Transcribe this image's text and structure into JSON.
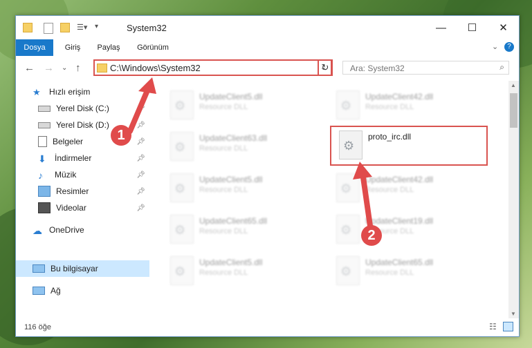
{
  "window": {
    "title": "System32",
    "controls": [
      "—",
      "☐",
      "✕"
    ]
  },
  "ribbon": {
    "tabs": [
      "Dosya",
      "Giriş",
      "Paylaş",
      "Görünüm"
    ]
  },
  "nav": {
    "address": "C:\\Windows\\System32",
    "search_placeholder": "Ara: System32"
  },
  "sidebar": {
    "items": [
      {
        "label": "Hızlı erişim",
        "icon": "star-icon"
      },
      {
        "label": "Yerel Disk (C:)",
        "icon": "drive-icon",
        "pinned": true
      },
      {
        "label": "Yerel Disk (D:)",
        "icon": "drive-icon",
        "pinned": true
      },
      {
        "label": "Belgeler",
        "icon": "documents-icon",
        "pinned": true
      },
      {
        "label": "İndirmeler",
        "icon": "download-icon",
        "pinned": true
      },
      {
        "label": "Müzik",
        "icon": "music-icon",
        "pinned": true
      },
      {
        "label": "Resimler",
        "icon": "pictures-icon",
        "pinned": true
      },
      {
        "label": "Videolar",
        "icon": "videos-icon",
        "pinned": true
      },
      {
        "label": "OneDrive",
        "icon": "onedrive-icon"
      },
      {
        "label": "Bu bilgisayar",
        "icon": "computer-icon",
        "selected": true
      },
      {
        "label": "Ağ",
        "icon": "network-icon"
      }
    ]
  },
  "files": [
    {
      "name": "UpdateClient5.dll",
      "desc": "Resource DLL"
    },
    {
      "name": "UpdateClient42.dll",
      "desc": "Resource DLL"
    },
    {
      "name": "UpdateClient63.dll",
      "desc": "Resource DLL"
    },
    {
      "name": "proto_irc.dll",
      "desc": ""
    },
    {
      "name": "UpdateClient5.dll",
      "desc": "Resource DLL"
    },
    {
      "name": "UpdateClient42.dll",
      "desc": "Resource DLL"
    },
    {
      "name": "UpdateClient65.dll",
      "desc": "Resource DLL"
    },
    {
      "name": "UpdateClient19.dll",
      "desc": "Resource DLL"
    },
    {
      "name": "UpdateClient5.dll",
      "desc": "Resource DLL"
    },
    {
      "name": "UpdateClient65.dll",
      "desc": "Resource DLL"
    }
  ],
  "status": {
    "count": "116 öğe"
  },
  "annotations": {
    "step1": "1",
    "step2": "2",
    "accent": "#e04b4b"
  }
}
